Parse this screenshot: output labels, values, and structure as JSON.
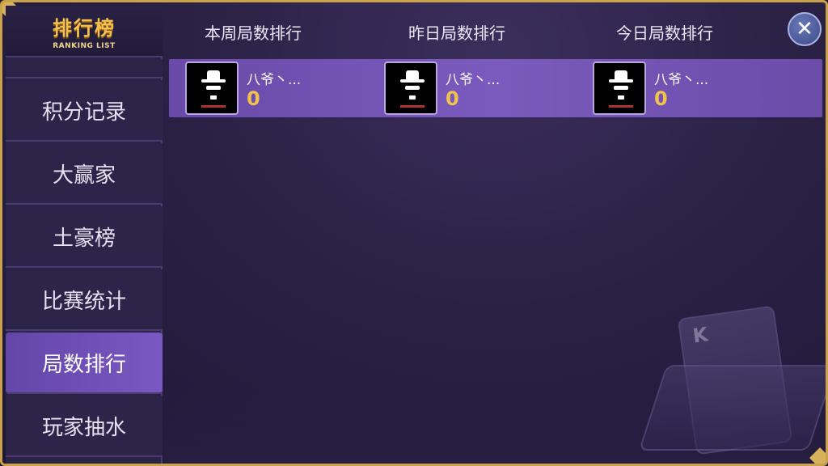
{
  "header": {
    "brand_title": "排行榜",
    "brand_subtitle": "RANKING LIST"
  },
  "sidebar": {
    "items": [
      {
        "label": "积分记录"
      },
      {
        "label": "大赢家"
      },
      {
        "label": "土豪榜"
      },
      {
        "label": "比赛统计"
      },
      {
        "label": "局数排行",
        "active": true
      },
      {
        "label": "玩家抽水"
      }
    ]
  },
  "tabs": [
    {
      "label": "本周局数排行"
    },
    {
      "label": "昨日局数排行"
    },
    {
      "label": "今日局数排行"
    }
  ],
  "close_button": {
    "label": "✕"
  },
  "rankings": [
    {
      "name": "八爷丶...",
      "score": "0",
      "avatar_icon": "gentleman-hat-avatar-icon"
    },
    {
      "name": "八爷丶...",
      "score": "0",
      "avatar_icon": "gentleman-hat-avatar-icon"
    },
    {
      "name": "八爷丶...",
      "score": "0",
      "avatar_icon": "gentleman-hat-avatar-icon"
    }
  ],
  "decor": {
    "card_letter": "K"
  },
  "colors": {
    "accent_gold": "#f2c24e",
    "active_tab": "#6446a8",
    "row_bg": "#7a5abc",
    "frame_gold": "#c9a24b"
  }
}
